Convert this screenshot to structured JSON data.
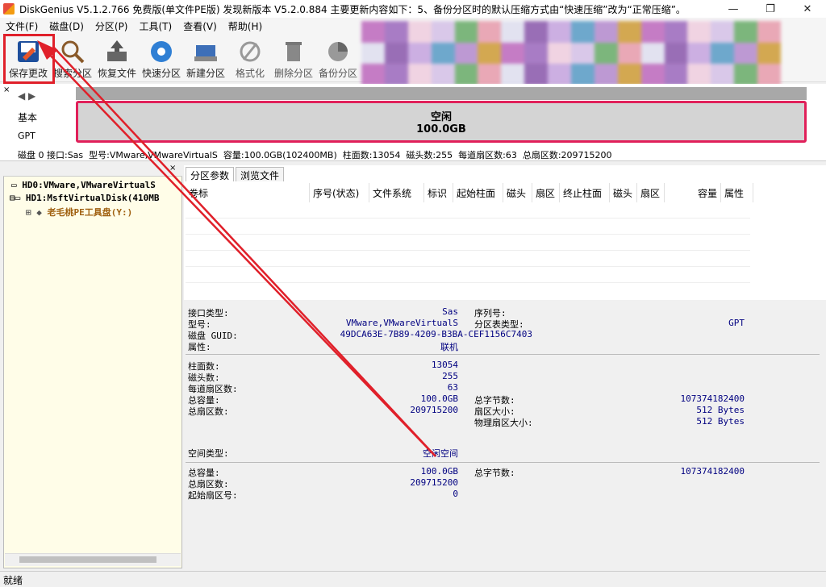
{
  "title": "DiskGenius V5.1.2.766 免费版(单文件PE版)   发现新版本 V5.2.0.884 主要更新内容如下：5、备份分区时的默认压缩方式由“快速压缩”改为“正常压缩”。",
  "window": {
    "min": "—",
    "max": "❐",
    "close": "✕"
  },
  "menu": [
    "文件(F)",
    "磁盘(D)",
    "分区(P)",
    "工具(T)",
    "查看(V)",
    "帮助(H)"
  ],
  "toolbar": [
    "保存更改",
    "搜索分区",
    "恢复文件",
    "快速分区",
    "新建分区",
    "格式化",
    "删除分区",
    "备份分区"
  ],
  "disk": {
    "type": "基本",
    "scheme": "GPT",
    "free_label": "空闲",
    "free_size": "100.0GB",
    "info": "磁盘 0 接口:Sas  型号:VMware,VMwareVirtualS  容量:100.0GB(102400MB)  柱面数:13054  磁头数:255  每道扇区数:63  总扇区数:209715200"
  },
  "tree": {
    "hd0": "HD0:VMware,VMwareVirtualS",
    "hd1": "HD1:MsftVirtualDisk(410MB",
    "part": "老毛桃PE工具盘(Y:)"
  },
  "tabs": [
    "分区参数",
    "浏览文件"
  ],
  "columns": [
    "卷标",
    "序号(状态)",
    "文件系统",
    "标识",
    "起始柱面",
    "磁头",
    "扇区",
    "终止柱面",
    "磁头",
    "扇区",
    "容量",
    "属性"
  ],
  "props": {
    "iface_l": "接口类型:",
    "iface_v": "Sas",
    "serial_l": "序列号:",
    "model_l": "型号:",
    "model_v": "VMware,VMwareVirtualS",
    "pt_l": "分区表类型:",
    "pt_v": "GPT",
    "guid_l": "磁盘 GUID:",
    "guid_v": "49DCA63E-7B89-4209-B3BA-CEF1156C7403",
    "attr_l": "属性:",
    "attr_v": "联机",
    "cyl_l": "柱面数:",
    "cyl_v": "13054",
    "heads_l": "磁头数:",
    "heads_v": "255",
    "spt_l": "每道扇区数:",
    "spt_v": "63",
    "cap_l": "总容量:",
    "cap_v": "100.0GB",
    "bytes_l": "总字节数:",
    "bytes_v": "107374182400",
    "sec_l": "总扇区数:",
    "sec_v": "209715200",
    "ss_l": "扇区大小:",
    "ss_v": "512 Bytes",
    "pss_l": "物理扇区大小:",
    "pss_v": "512 Bytes",
    "space_l": "空间类型:",
    "space_v": "空闲空间",
    "cap2_l": "总容量:",
    "cap2_v": "100.0GB",
    "bytes2_l": "总字节数:",
    "bytes2_v": "107374182400",
    "sec2_l": "总扇区数:",
    "sec2_v": "209715200",
    "start_l": "起始扇区号:",
    "start_v": "0"
  },
  "status": "就绪",
  "colors": {
    "highlight": "#e0202a",
    "value_text": "#000080",
    "tree_bg": "#fffde8"
  }
}
